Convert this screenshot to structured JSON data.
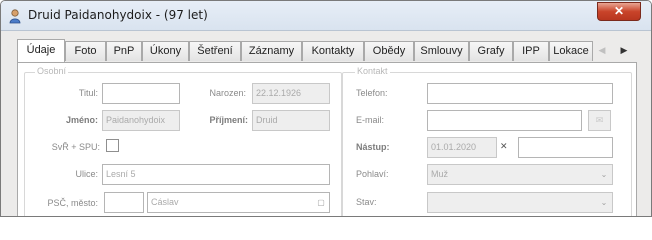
{
  "window": {
    "title": "Druid Paidanohydoix - (97 let)",
    "close_label": "✕"
  },
  "tabs": [
    {
      "label": "Údaje",
      "active": true
    },
    {
      "label": "Foto"
    },
    {
      "label": "PnP"
    },
    {
      "label": "Úkony"
    },
    {
      "label": "Šetření"
    },
    {
      "label": "Záznamy"
    },
    {
      "label": "Kontakty"
    },
    {
      "label": "Obědy"
    },
    {
      "label": "Smlouvy"
    },
    {
      "label": "Grafy"
    },
    {
      "label": "IPP"
    },
    {
      "label": "Lokace"
    }
  ],
  "tab_scroll": {
    "left_icon": "◀",
    "right_icon": "▶"
  },
  "left_group": {
    "title": "Osobní",
    "labels": {
      "titul": "Titul:",
      "jmeno": "Jméno:",
      "narozen": "Narozen:",
      "prijmeni": "Příjmení:",
      "svz": "SvŘ + SPU:",
      "ulice": "Ulice:",
      "psc": "PSČ, město:"
    },
    "values": {
      "titul": "",
      "jmeno": "Paidanohydoix",
      "narozen": "22.12.1926",
      "prijmeni": "Druid",
      "ulice": "Lesní 5",
      "psc": "",
      "mesto": "Cáslav"
    }
  },
  "right_group": {
    "title": "Kontakt",
    "labels": {
      "telefon": "Telefon:",
      "email": "E-mail:",
      "nastup": "Nástup:",
      "pohlavi": "Pohlaví:",
      "stav": "Stav:"
    },
    "values": {
      "telefon": "",
      "email": "",
      "nastup": "01.01.2020",
      "nastup_extra": "",
      "pohlavi": "Muž",
      "stav": ""
    }
  },
  "icons": {
    "app": "person-icon",
    "dropdown": "chevron-down-icon",
    "clear": "clear-x-icon"
  }
}
